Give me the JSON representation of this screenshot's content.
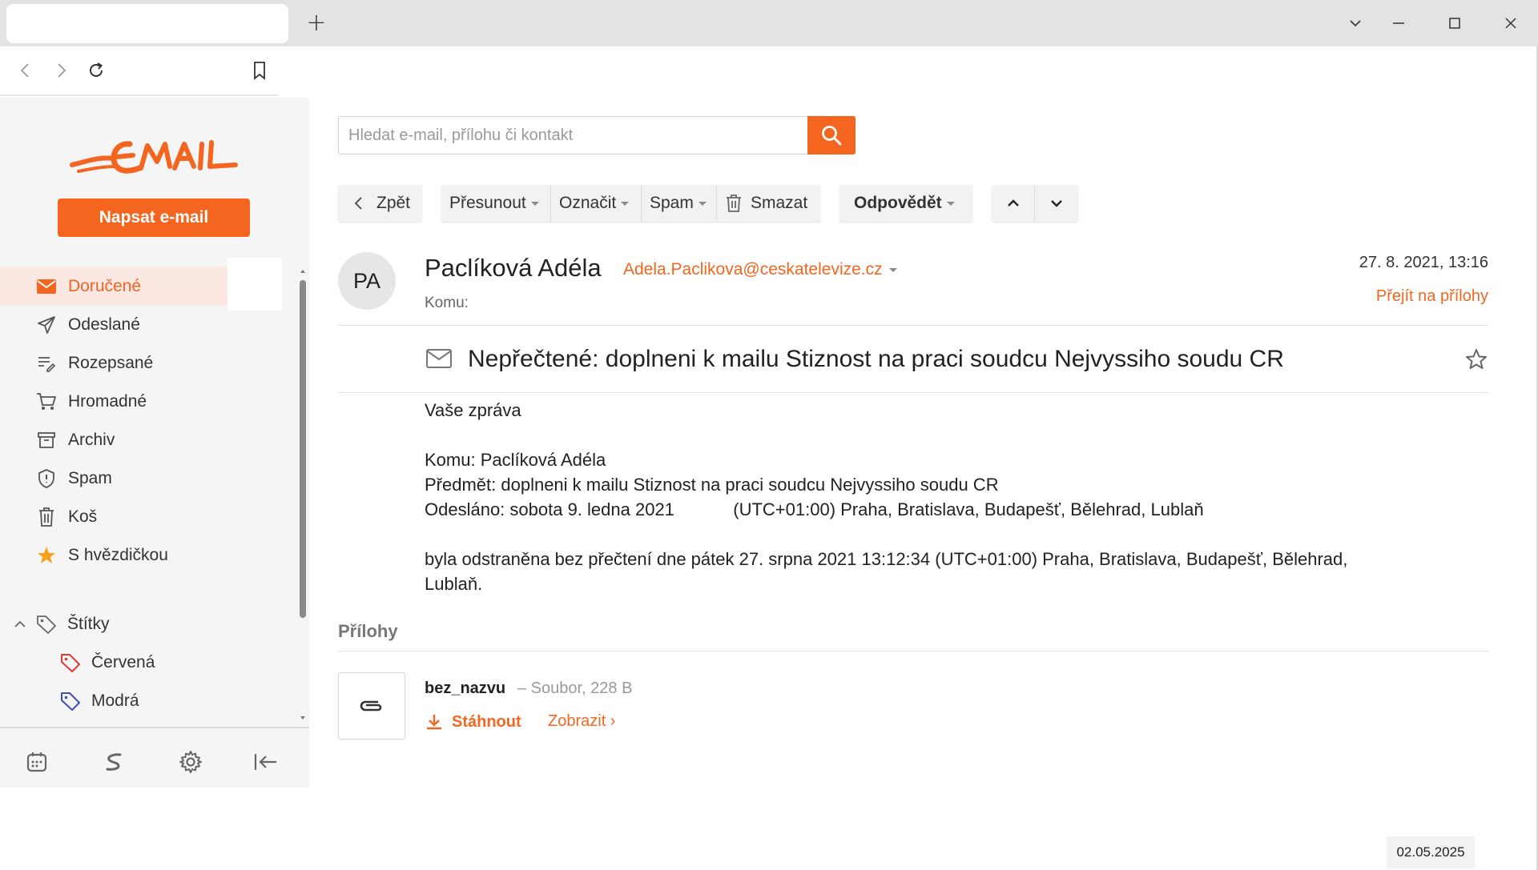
{
  "browser": {
    "new_tab": "+",
    "icons": [
      "chevron-left-icon",
      "chevron-right-icon",
      "reload-icon",
      "bookmark-icon",
      "chevron-down-icon",
      "minimize-icon",
      "maximize-icon",
      "close-icon"
    ]
  },
  "sidebar": {
    "compose_label": "Napsat e-mail",
    "folders": [
      {
        "label": "Doručené",
        "icon": "inbox-icon",
        "active": true
      },
      {
        "label": "Odeslané",
        "icon": "send-icon"
      },
      {
        "label": "Rozepsané",
        "icon": "drafts-icon"
      },
      {
        "label": "Hromadné",
        "icon": "cart-icon"
      },
      {
        "label": "Archiv",
        "icon": "archive-icon"
      },
      {
        "label": "Spam",
        "icon": "shield-icon"
      },
      {
        "label": "Koš",
        "icon": "trash-icon"
      },
      {
        "label": "S hvězdičkou",
        "icon": "star-icon"
      }
    ],
    "labels_heading": "Štítky",
    "labels": [
      {
        "label": "Červená",
        "color": "#e53935"
      },
      {
        "label": "Modrá",
        "color": "#3f51b5"
      }
    ],
    "accent": "#f4651f"
  },
  "search": {
    "placeholder": "Hledat e-mail, přílohu či kontakt"
  },
  "toolbar": {
    "back": "Zpět",
    "move": "Přesunout",
    "mark": "Označit",
    "spam": "Spam",
    "delete": "Smazat",
    "reply": "Odpovědět"
  },
  "message": {
    "avatar_initials": "PA",
    "sender_name": "Paclíková Adéla",
    "sender_email": "Adela.Paclikova@ceskatelevize.cz",
    "to_label": "Komu:",
    "date": "27. 8. 2021, 13:16",
    "attachments_link": "Přejít na přílohy",
    "subject": "Nepřečtené: doplneni k mailu Stiznost na praci soudcu Nejvyssiho soudu CR",
    "body": {
      "line1": "Vaše zpráva",
      "line2": "Komu: Paclíková Adéla",
      "line3": "Předmět: doplneni k mailu Stiznost na praci soudcu Nejvyssiho soudu CR",
      "line4": "Odesláno: sobota 9. ledna 2021            (UTC+01:00) Praha, Bratislava, Budapešť, Bělehrad, Lublaň",
      "line5": "byla odstraněna bez přečtení dne pátek 27. srpna 2021 13:12:34 (UTC+01:00) Praha, Bratislava, Budapešť, Bělehrad,",
      "line6": "Lublaň."
    }
  },
  "attachments": {
    "heading": "Přílohy",
    "items": [
      {
        "name": "bez_nazvu",
        "meta": "– Soubor, 228 B",
        "download": "Stáhnout",
        "show": "Zobrazit ›"
      }
    ]
  },
  "footer": {
    "date_stamp": "02.05.2025"
  }
}
